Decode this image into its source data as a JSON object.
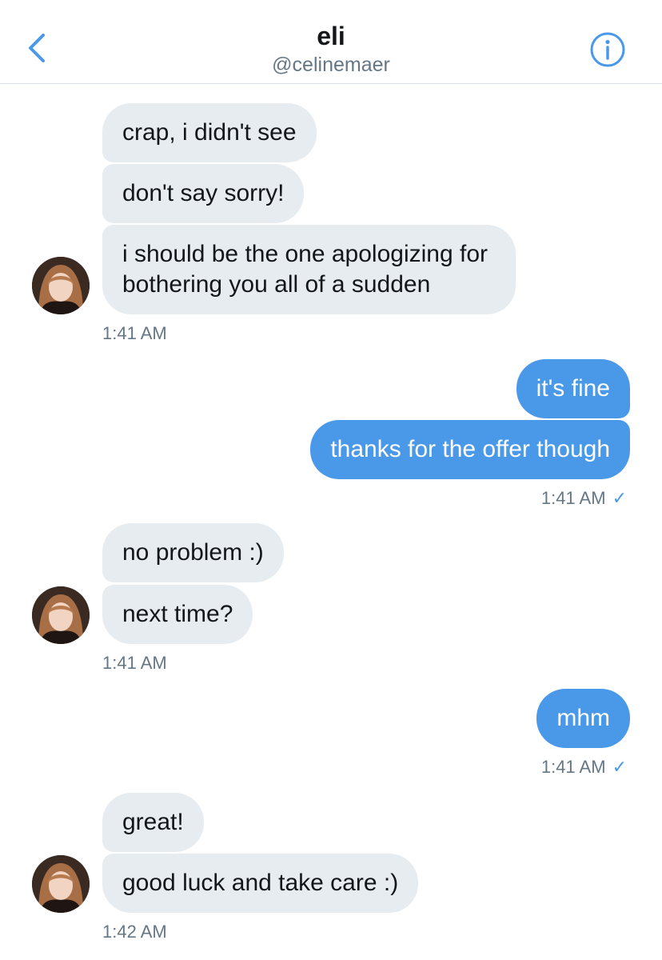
{
  "header": {
    "title": "eli",
    "handle": "@celinemaer"
  },
  "messages": [
    {
      "text": "crap, i didn't see"
    },
    {
      "text": "don't say sorry!"
    },
    {
      "text": "i should be the one apologizing for bothering you all of a sudden"
    },
    {
      "text": "it's fine"
    },
    {
      "text": "thanks for the offer though"
    },
    {
      "text": "no problem :)"
    },
    {
      "text": "next time?"
    },
    {
      "text": "mhm"
    },
    {
      "text": "great!"
    },
    {
      "text": "good luck and take care :)"
    }
  ],
  "timestamps": [
    "1:41 AM",
    "1:41 AM",
    "1:41 AM",
    "1:41 AM",
    "1:42 AM"
  ],
  "colors": {
    "accent": "#4a99e9",
    "incoming_bubble": "#e6ecf0",
    "text": "#14171a",
    "secondary_text": "#657786"
  },
  "icons": {
    "back": "chevron-left-icon",
    "info": "info-icon",
    "read": "checkmark-icon"
  },
  "read_mark": "✓"
}
